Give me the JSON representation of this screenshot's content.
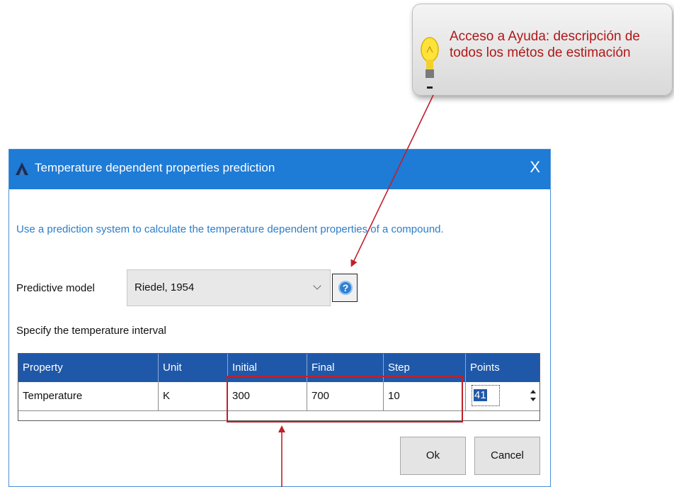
{
  "callout": {
    "text": "Acceso a Ayuda: descripción de todos los métos de estimación",
    "text_color": "#b01818",
    "icon": "lightbulb-icon"
  },
  "dialog": {
    "title": "Temperature dependent properties prediction",
    "close_label": "X",
    "titlebar_color": "#1e7bd6",
    "description": "Use a prediction system to calculate the temperature dependent properties of a compound.",
    "predictive_model": {
      "label": "Predictive model",
      "selected": "Riedel, 1954",
      "help_icon": "help-icon"
    },
    "interval_label": "Specify the temperature interval",
    "table": {
      "headers": [
        "Property",
        "Unit",
        "Initial",
        "Final",
        "Step",
        "Points"
      ],
      "header_color": "#1f58a8",
      "row": {
        "property": "Temperature",
        "unit": "K",
        "initial": "300",
        "final": "700",
        "step": "10",
        "points": "41"
      }
    },
    "ok_label": "Ok",
    "cancel_label": "Cancel"
  },
  "annotation_color": "#c0202a"
}
